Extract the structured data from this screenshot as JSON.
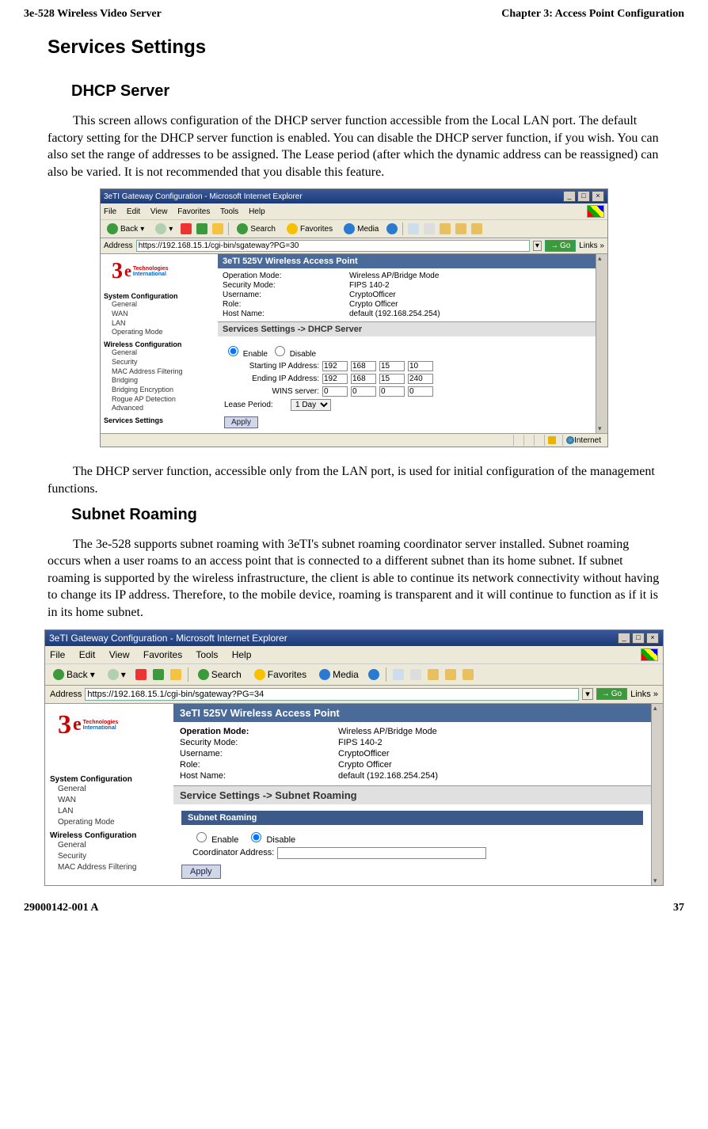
{
  "header": {
    "left": "3e-528 Wireless Video Server",
    "right": "Chapter 3: Access Point Configuration"
  },
  "h1": "Services Settings",
  "dhcp": {
    "heading": "DHCP Server",
    "para1": "This screen allows configuration of the DHCP server function accessible from the Local LAN port. The default factory setting for the DHCP server function is enabled. You can disable the DHCP server function, if you wish. You can also set the range of addresses to be assigned. The Lease period (after which the dynamic address can be reassigned) can also be varied. It is not recommended that you disable this feature.",
    "para2": "The DHCP server function, accessible only from the LAN port, is used  for initial configuration of the management functions."
  },
  "subnet": {
    "heading": "Subnet Roaming",
    "para": "The 3e-528 supports subnet roaming with 3eTI's subnet roaming coordinator server installed. Subnet roaming occurs when a user roams to an access point that is connected to a different subnet than its home subnet. If subnet roaming is supported by the wireless infrastructure, the client is able to continue its network connectivity without having to change its IP address. Therefore, to the mobile device, roaming is transparent and it will continue to function as if it is in its home subnet."
  },
  "browser": {
    "title": "3eTI Gateway Configuration - Microsoft Internet Explorer",
    "menus": [
      "File",
      "Edit",
      "View",
      "Favorites",
      "Tools",
      "Help"
    ],
    "toolbar": {
      "back": "Back",
      "search": "Search",
      "favorites": "Favorites",
      "media": "Media"
    },
    "address_label": "Address",
    "go": "Go",
    "links": "Links",
    "url_dhcp": "https://192.168.15.1/cgi-bin/sgateway?PG=30",
    "url_subnet": "https://192.168.15.1/cgi-bin/sgateway?PG=34",
    "status_internet": "Internet"
  },
  "logo": {
    "brand1": "Technologies",
    "brand2": "International"
  },
  "ap": {
    "title": "3eTI 525V Wireless Access Point",
    "fields": {
      "op_mode_l": "Operation Mode:",
      "op_mode_v": "Wireless AP/Bridge Mode",
      "sec_mode_l": "Security Mode:",
      "sec_mode_v": "FIPS 140-2",
      "user_l": "Username:",
      "user_v": "CryptoOfficer",
      "role_l": "Role:",
      "role_v": "Crypto Officer",
      "host_l": "Host Name:",
      "host_v": "default (192.168.254.254)"
    }
  },
  "nav": {
    "syscfg": "System Configuration",
    "sys_items": [
      "General",
      "WAN",
      "LAN",
      "Operating Mode"
    ],
    "wcfg": "Wireless Configuration",
    "w_items_small": [
      "General",
      "Security",
      "MAC Address Filtering",
      "Bridging",
      "Bridging Encryption",
      "Rogue AP Detection",
      "Advanced"
    ],
    "w_items_large": [
      "General",
      "Security",
      "MAC Address Filtering"
    ],
    "svcset": "Services Settings"
  },
  "dhcp_form": {
    "section": "Services Settings -> DHCP Server",
    "enable": "Enable",
    "disable": "Disable",
    "start_l": "Starting IP Address:",
    "start": [
      "192",
      "168",
      "15",
      "10"
    ],
    "end_l": "Ending IP Address:",
    "end": [
      "192",
      "168",
      "15",
      "240"
    ],
    "wins_l": "WINS server:",
    "wins": [
      "0",
      "0",
      "0",
      "0"
    ],
    "lease_l": "Lease Period:",
    "lease_v": "1 Day",
    "apply": "Apply"
  },
  "subnet_form": {
    "section": "Service Settings -> Subnet Roaming",
    "bar": "Subnet Roaming",
    "enable": "Enable",
    "disable": "Disable",
    "coord_l": "Coordinator Address:",
    "apply": "Apply"
  },
  "footer": {
    "left": "29000142-001 A",
    "right": "37"
  }
}
